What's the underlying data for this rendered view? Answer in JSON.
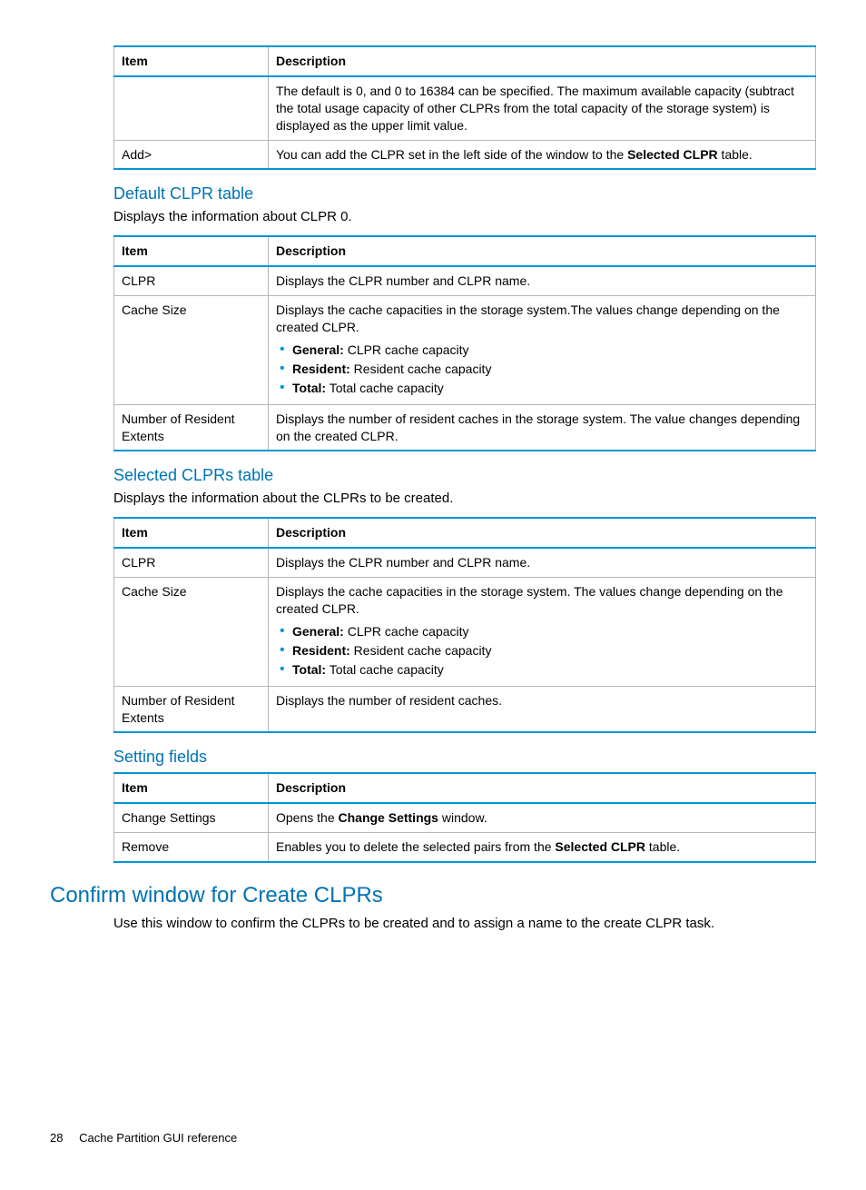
{
  "tables": {
    "first": {
      "head_item": "Item",
      "head_desc": "Description",
      "rows": [
        {
          "item": "",
          "desc": "The default is 0, and 0 to 16384 can be specified. The maximum available capacity (subtract the total usage capacity of other CLPRs from the total capacity of the storage system) is displayed as the upper limit value."
        },
        {
          "item": "Add>",
          "desc_pre": "You can add the CLPR set in the left side of the window to the ",
          "desc_bold": "Selected CLPR",
          "desc_post": " table."
        }
      ]
    },
    "default_clpr": {
      "heading": "Default CLPR table",
      "intro": "Displays the information about CLPR 0.",
      "head_item": "Item",
      "head_desc": "Description",
      "rows": {
        "r1_item": "CLPR",
        "r1_desc": "Displays the CLPR number and CLPR name.",
        "r2_item": "Cache Size",
        "r2_desc_intro": "Displays the cache capacities in the storage system.The values change depending on the created CLPR.",
        "r2_b1_label": "General:",
        "r2_b1_text": " CLPR cache capacity",
        "r2_b2_label": "Resident:",
        "r2_b2_text": " Resident cache capacity",
        "r2_b3_label": "Total:",
        "r2_b3_text": " Total cache capacity",
        "r3_item": "Number of Resident Extents",
        "r3_desc": "Displays the number of resident caches in the storage system. The value changes depending on the created CLPR."
      }
    },
    "selected_clprs": {
      "heading": "Selected CLPRs table",
      "intro": "Displays the information about the CLPRs to be created.",
      "head_item": "Item",
      "head_desc": "Description",
      "rows": {
        "r1_item": "CLPR",
        "r1_desc": "Displays the CLPR number and CLPR name.",
        "r2_item": "Cache Size",
        "r2_desc_intro": "Displays the cache capacities in the storage system. The values change depending on the created CLPR.",
        "r2_b1_label": "General:",
        "r2_b1_text": " CLPR cache capacity",
        "r2_b2_label": "Resident:",
        "r2_b2_text": " Resident cache capacity",
        "r2_b3_label": "Total:",
        "r2_b3_text": " Total cache capacity",
        "r3_item": "Number of Resident Extents",
        "r3_desc": "Displays the number of resident caches."
      }
    },
    "setting_fields": {
      "heading": "Setting fields",
      "head_item": "Item",
      "head_desc": "Description",
      "rows": {
        "r1_item": "Change Settings",
        "r1_pre": "Opens the ",
        "r1_bold": "Change Settings",
        "r1_post": " window.",
        "r2_item": "Remove",
        "r2_pre": "Enables you to delete the selected pairs from the ",
        "r2_bold": "Selected CLPR",
        "r2_post": " table."
      }
    }
  },
  "confirm": {
    "heading": "Confirm window for Create CLPRs",
    "intro": "Use this window to confirm the CLPRs to be created and to assign a name to the create CLPR task."
  },
  "footer": {
    "page_number": "28",
    "chapter": "Cache Partition GUI reference"
  }
}
